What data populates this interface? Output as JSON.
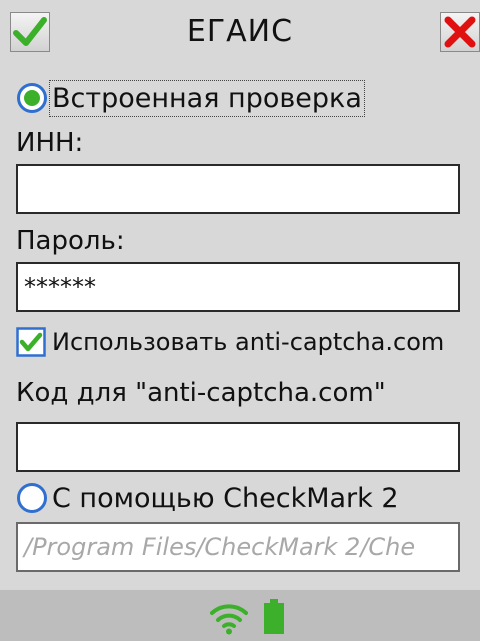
{
  "header": {
    "title": "ЕГАИС",
    "ok_icon": "check-icon",
    "close_icon": "close-icon"
  },
  "builtin_check": {
    "label": "Встроенная проверка",
    "selected": true
  },
  "inn": {
    "label": "ИНН:",
    "value": ""
  },
  "password": {
    "label": "Пароль:",
    "value": "******"
  },
  "anticaptcha": {
    "label": "Использовать anti-captcha.com",
    "checked": true
  },
  "anticaptcha_code": {
    "label": "Код для \"anti-captcha.com\"",
    "value": ""
  },
  "checkmark": {
    "label": "С помощью CheckMark 2",
    "selected": false,
    "path_value": "/Program Files/CheckMark 2/Che"
  },
  "statusbar": {
    "wifi_icon": "wifi-icon",
    "battery_icon": "battery-icon"
  },
  "colors": {
    "accent_green": "#3cb02a",
    "close_red": "#e01010",
    "radio_blue": "#2e6fd0",
    "background": "#d8d8d8",
    "statusbar": "#bdbdbd"
  }
}
